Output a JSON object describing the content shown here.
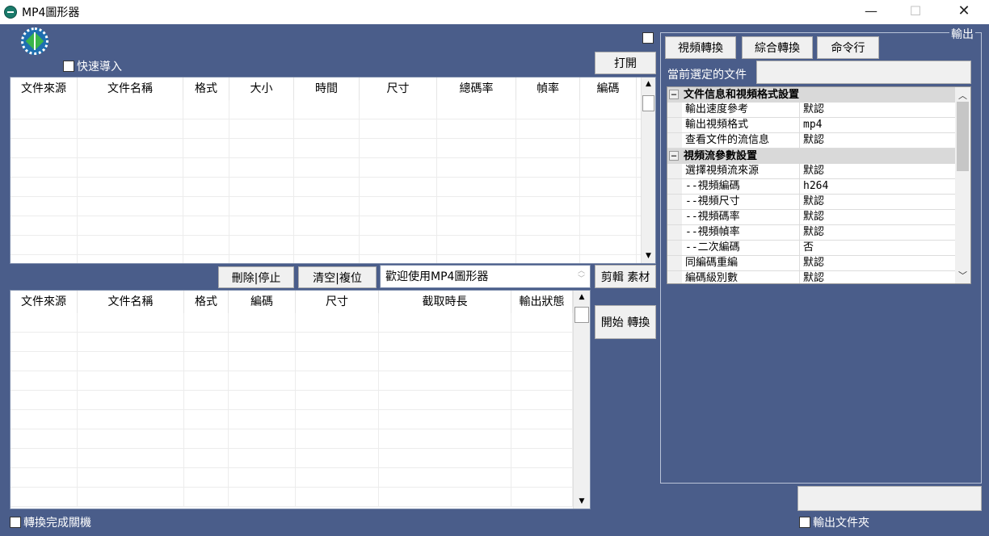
{
  "window": {
    "title": "MP4圖形器",
    "minimize": "—",
    "maximize": "☐",
    "close": "✕"
  },
  "top": {
    "quick_import": "快速導入",
    "open_button": "打開"
  },
  "source_grid": {
    "columns": [
      "文件來源",
      "文件名稱",
      "格式",
      "大小",
      "時間",
      "尺寸",
      "總碼率",
      "幀率",
      "編碼"
    ]
  },
  "toolbar": {
    "delete_stop": "刪除|停止",
    "clear_reset": "清空|複位",
    "message": "歡迎使用MP4圖形器",
    "clip_material": "剪輯 素材",
    "start_convert": "開始 轉換"
  },
  "output_grid": {
    "columns": [
      "文件來源",
      "文件名稱",
      "格式",
      "編碼",
      "尺寸",
      "截取時長",
      "輸出狀態"
    ]
  },
  "bottom": {
    "shutdown_after": "轉換完成關機",
    "output_folder": "輸出文件夾"
  },
  "right": {
    "group_label": "輸出",
    "tabs": [
      "視頻轉換",
      "綜合轉換",
      "命令行"
    ],
    "current_file_label": "當前選定的文件",
    "properties": [
      {
        "type": "category",
        "name": "文件信息和視頻格式設置"
      },
      {
        "type": "item",
        "name": "輸出速度參考",
        "value": "默認"
      },
      {
        "type": "item",
        "name": "輸出視頻格式",
        "value": "mp4"
      },
      {
        "type": "item",
        "name": "查看文件的流信息",
        "value": "默認"
      },
      {
        "type": "category",
        "name": "視頻流參數設置"
      },
      {
        "type": "item",
        "name": "選擇視頻流來源",
        "value": "默認"
      },
      {
        "type": "item",
        "name": "--視頻編碼",
        "value": "h264"
      },
      {
        "type": "item",
        "name": "--視頻尺寸",
        "value": "默認"
      },
      {
        "type": "item",
        "name": "--視頻碼率",
        "value": "默認"
      },
      {
        "type": "item",
        "name": "--視頻幀率",
        "value": "默認"
      },
      {
        "type": "item",
        "name": "--二次編碼",
        "value": "否"
      },
      {
        "type": "item",
        "name": "同編碼重編",
        "value": "默認"
      },
      {
        "type": "item",
        "name": "編碼級別數",
        "value": "默認"
      }
    ]
  }
}
